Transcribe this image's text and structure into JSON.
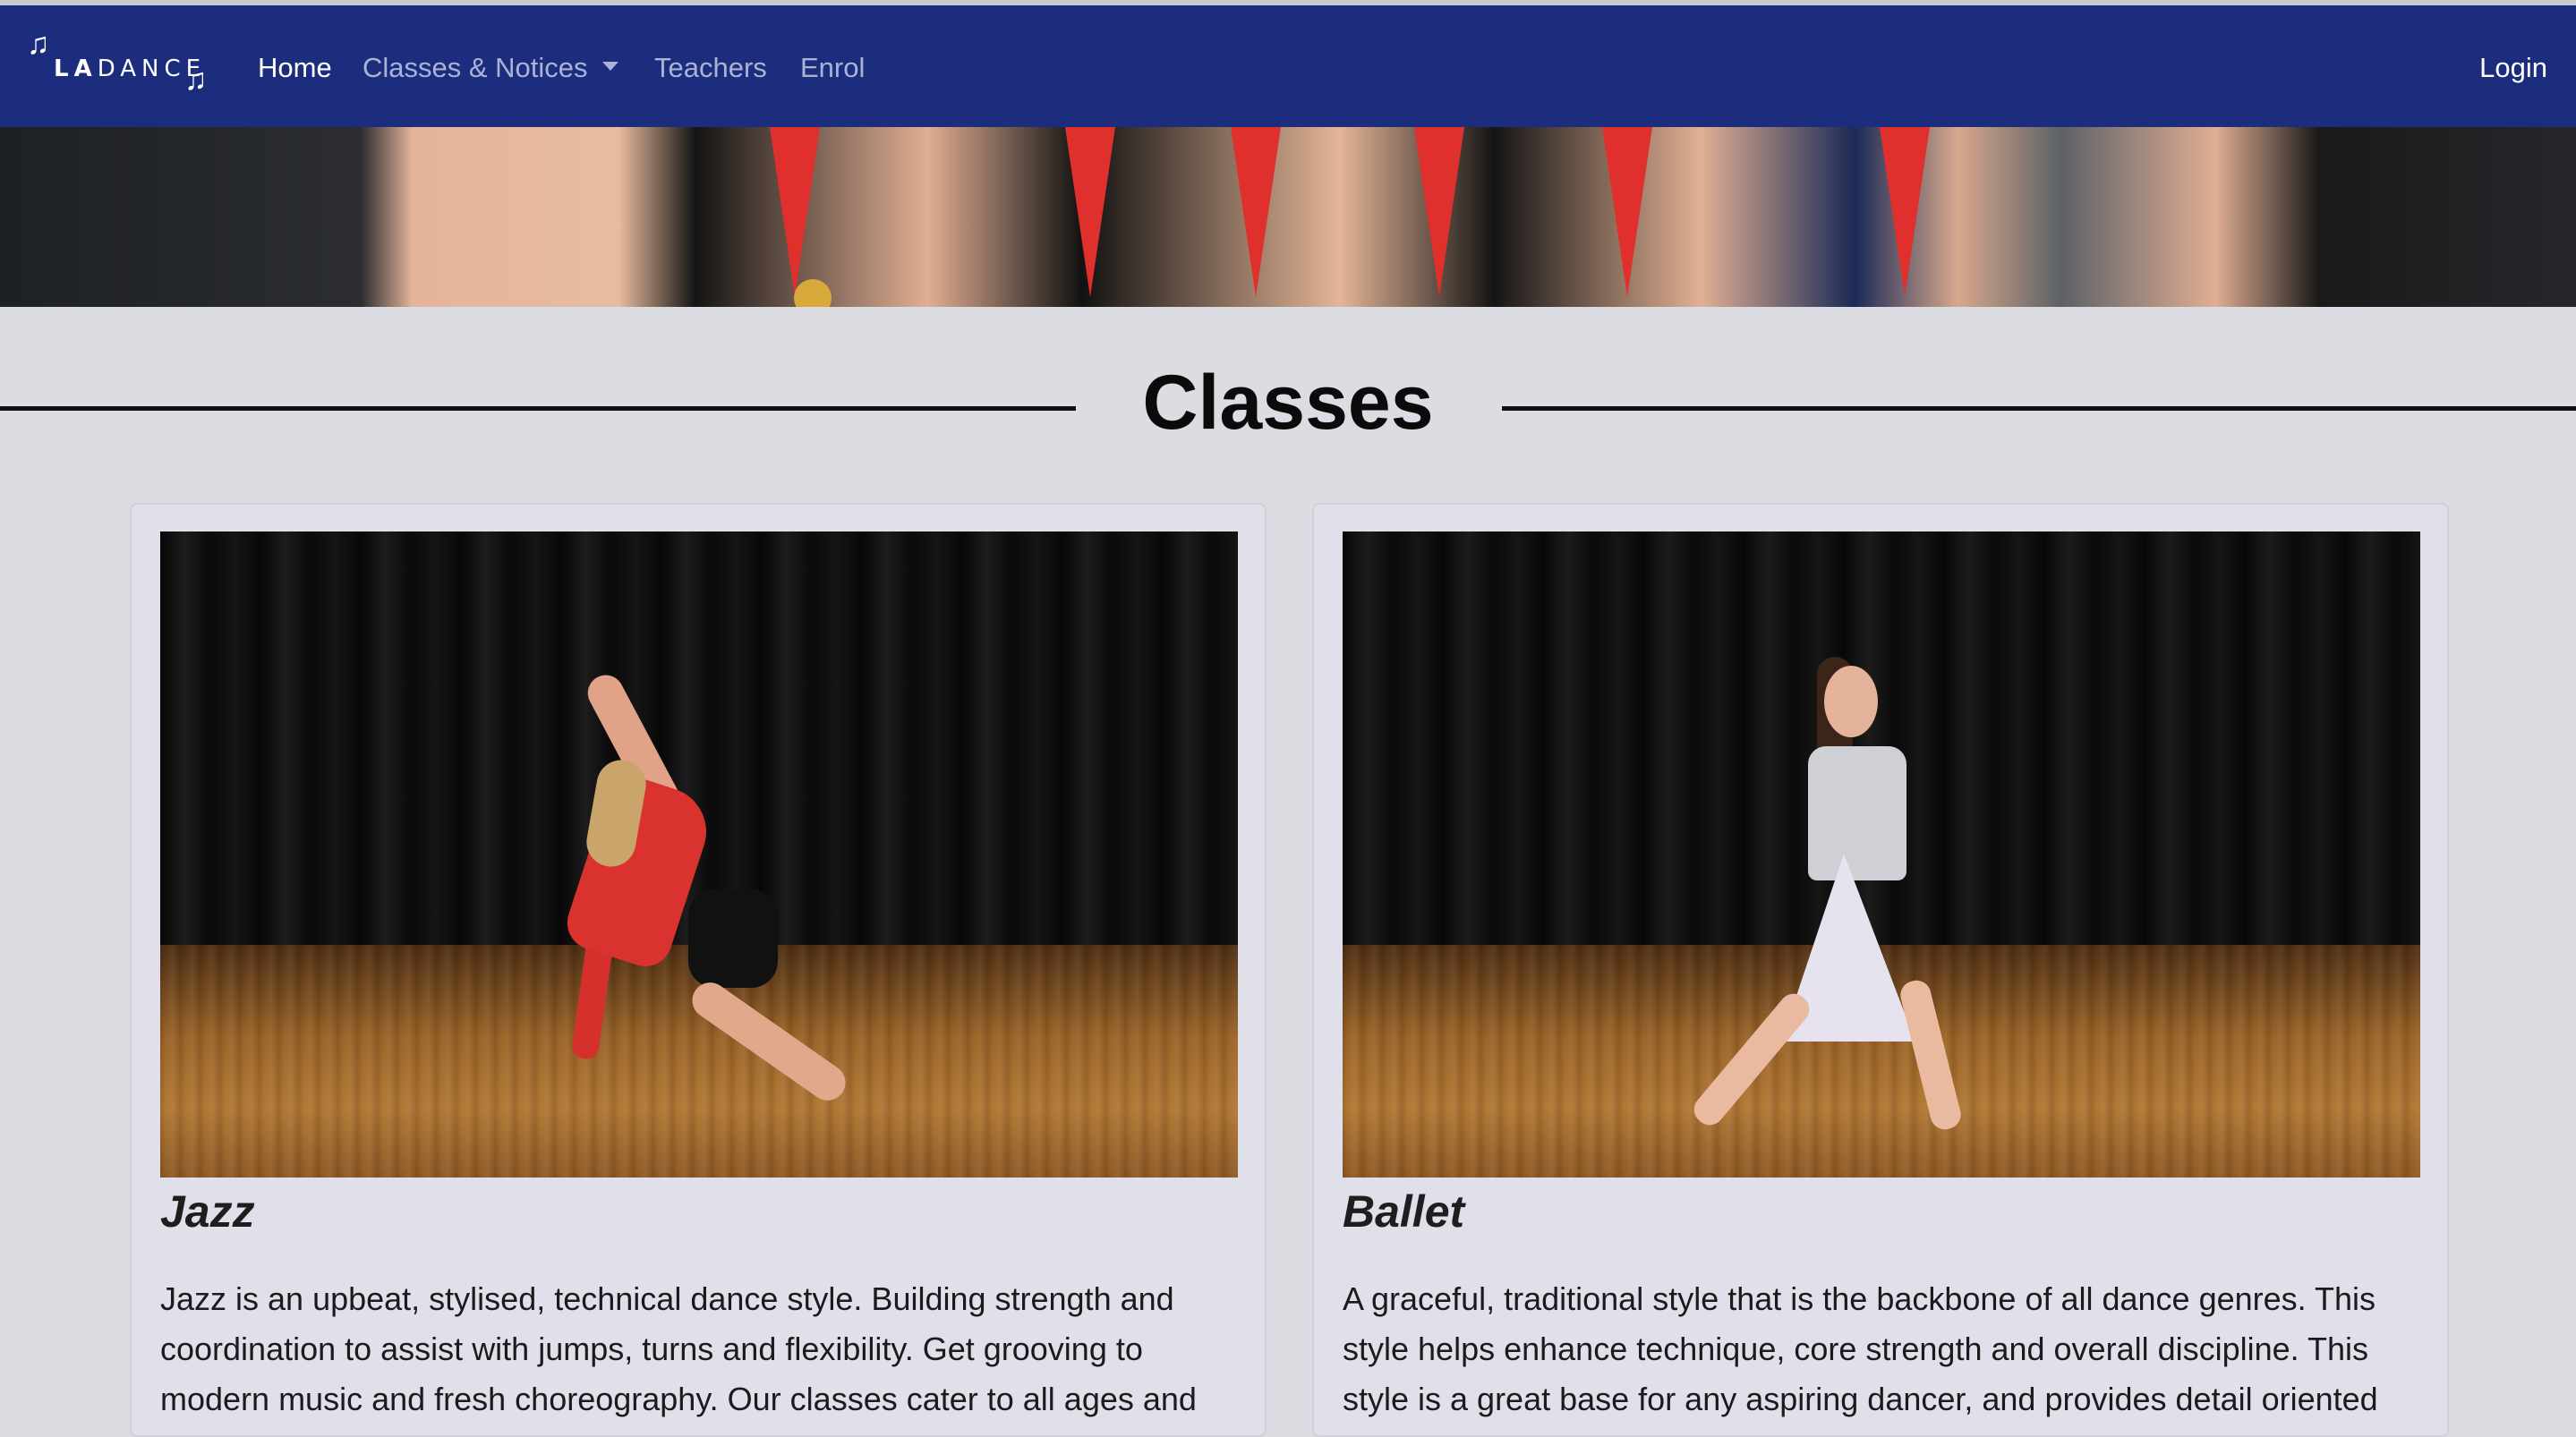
{
  "nav": {
    "logo_text_bold": "LA",
    "logo_text_light": "DANCE",
    "logo_note_glyph": "♫",
    "links": {
      "home": "Home",
      "classes_notices": "Classes & Notices",
      "teachers": "Teachers",
      "enrol": "Enrol"
    },
    "login": "Login",
    "colors": {
      "bar": "#1c2d7e",
      "link": "#aab3d6",
      "active": "#ffffff"
    }
  },
  "section": {
    "heading": "Classes"
  },
  "cards": [
    {
      "title": "Jazz",
      "text": "Jazz is an upbeat, stylised, technical dance style. Building strength and coordination to assist with jumps, turns and flexibility. Get grooving to modern music and fresh choreography. Our classes cater to all ages and"
    },
    {
      "title": "Ballet",
      "text": "A graceful, traditional style that is the backbone of all dance genres. This style helps enhance technique, core strength and overall discipline. This style is a great base for any aspiring dancer, and provides detail oriented"
    }
  ]
}
